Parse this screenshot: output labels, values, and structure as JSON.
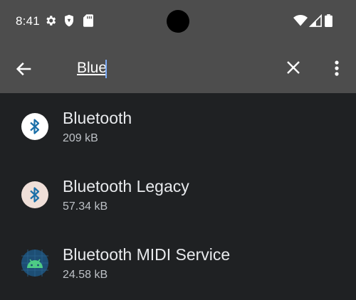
{
  "status_bar": {
    "time": "8:41",
    "icons": [
      "gear-icon",
      "shield-icon",
      "sd-card-icon",
      "wifi-icon",
      "signal-icon",
      "battery-icon"
    ]
  },
  "toolbar": {
    "search_value": "Blue",
    "back_icon": "arrow-back-icon",
    "clear_icon": "close-icon",
    "more_icon": "more-vert-icon"
  },
  "apps": [
    {
      "name": "Bluetooth",
      "size": "209 kB",
      "icon": "bluetooth-icon"
    },
    {
      "name": "Bluetooth Legacy",
      "size": "57.34 kB",
      "icon": "bluetooth-legacy-icon"
    },
    {
      "name": "Bluetooth MIDI Service",
      "size": "24.58 kB",
      "icon": "android-icon"
    }
  ],
  "colors": {
    "bar_background": "#4d4d4d",
    "page_background": "#1f2123",
    "bluetooth_accent": "#1a6fa8",
    "android_accent": "#4ecb85"
  }
}
